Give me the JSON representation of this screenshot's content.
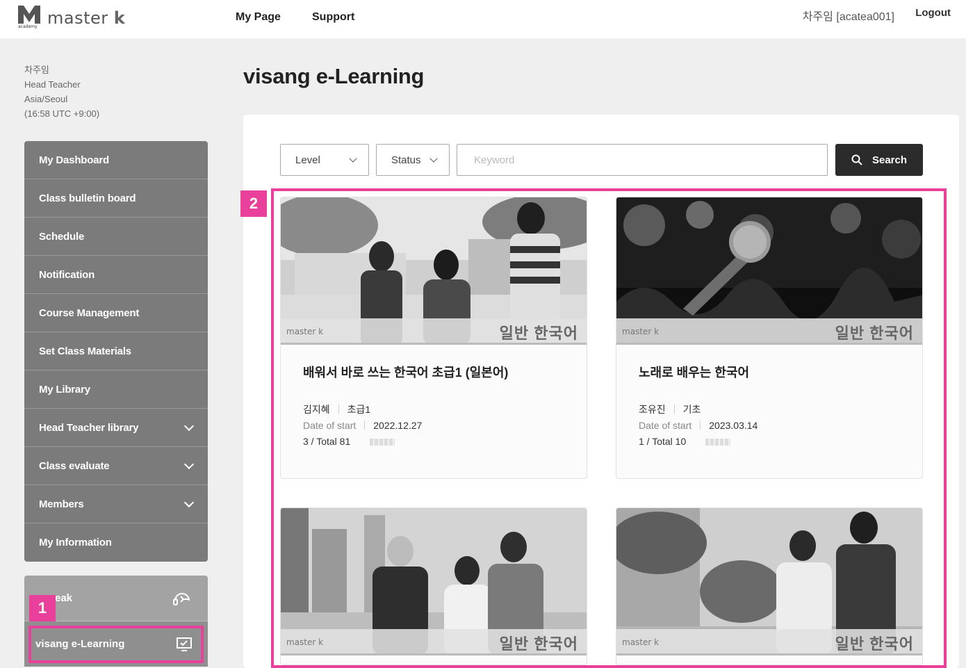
{
  "header": {
    "logo_text": "master",
    "logo_k": "k",
    "logo_sub": "academy",
    "nav": [
      "My Page",
      "Support"
    ],
    "user": "차주임 [acatea001]",
    "logout": "Logout"
  },
  "profile": {
    "name": "차주임",
    "role": "Head Teacher",
    "timezone": "Asia/Seoul",
    "time": "(16:58 UTC +9:00)"
  },
  "sidebar": {
    "items": [
      {
        "label": "My Dashboard"
      },
      {
        "label": "Class bulletin board"
      },
      {
        "label": "Schedule"
      },
      {
        "label": "Notification"
      },
      {
        "label": "Course Management"
      },
      {
        "label": "Set Class Materials"
      },
      {
        "label": "My Library"
      },
      {
        "label": "Head Teacher library"
      },
      {
        "label": "Class evaluate"
      },
      {
        "label": "Members"
      },
      {
        "label": "My Information"
      }
    ],
    "speak_label": "eak",
    "elearning_label": "visang e-Learning"
  },
  "badges": {
    "one": "1",
    "two": "2"
  },
  "page": {
    "title": "visang e-Learning"
  },
  "filters": {
    "level": "Level",
    "status": "Status",
    "keyword_placeholder": "Keyword",
    "search_label": "Search"
  },
  "courses": [
    {
      "category": "일반 한국어",
      "brand": "master k",
      "title": "배워서 바로 쓰는 한국어 초급1 (일본어)",
      "teacher": "김지혜",
      "level": "초급1",
      "start_label": "Date of start",
      "start_date": "2022.12.27",
      "progress_text": "3 / Total 81"
    },
    {
      "category": "일반 한국어",
      "brand": "master k",
      "title": "노래로 배우는 한국어",
      "teacher": "조유진",
      "level": "기초",
      "start_label": "Date of start",
      "start_date": "2023.03.14",
      "progress_text": "1 / Total 10"
    },
    {
      "category": "일반 한국어",
      "brand": "master k"
    },
    {
      "category": "일반 한국어",
      "brand": "master k"
    }
  ],
  "colors": {
    "highlight": "#e8409b",
    "sidebar": "#7b7b7b",
    "search_button": "#2b2b2b"
  }
}
